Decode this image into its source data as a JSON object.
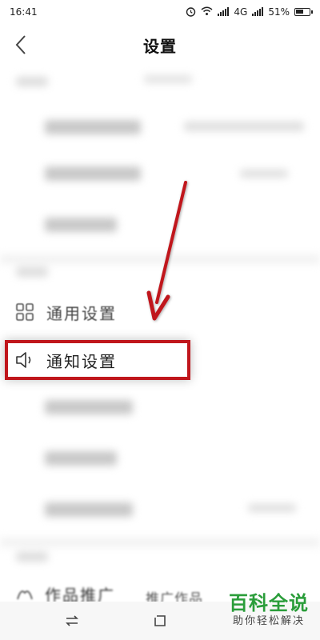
{
  "status_bar": {
    "time": "16:41",
    "network": "4G",
    "battery": "51%"
  },
  "header": {
    "title": "设置"
  },
  "settings": {
    "general": {
      "label": "通用设置",
      "icon": "grid-icon"
    },
    "notification": {
      "label": "通知设置",
      "icon": "speaker-icon"
    },
    "bottom_partial_left": "作品推广",
    "bottom_partial_right": "推广作品"
  },
  "watermark": {
    "main": "百科全说",
    "sub": "助你轻松解决"
  },
  "colors": {
    "highlight": "#c0161c",
    "arrow": "#c0161c",
    "watermark": "#2a9d3a"
  }
}
